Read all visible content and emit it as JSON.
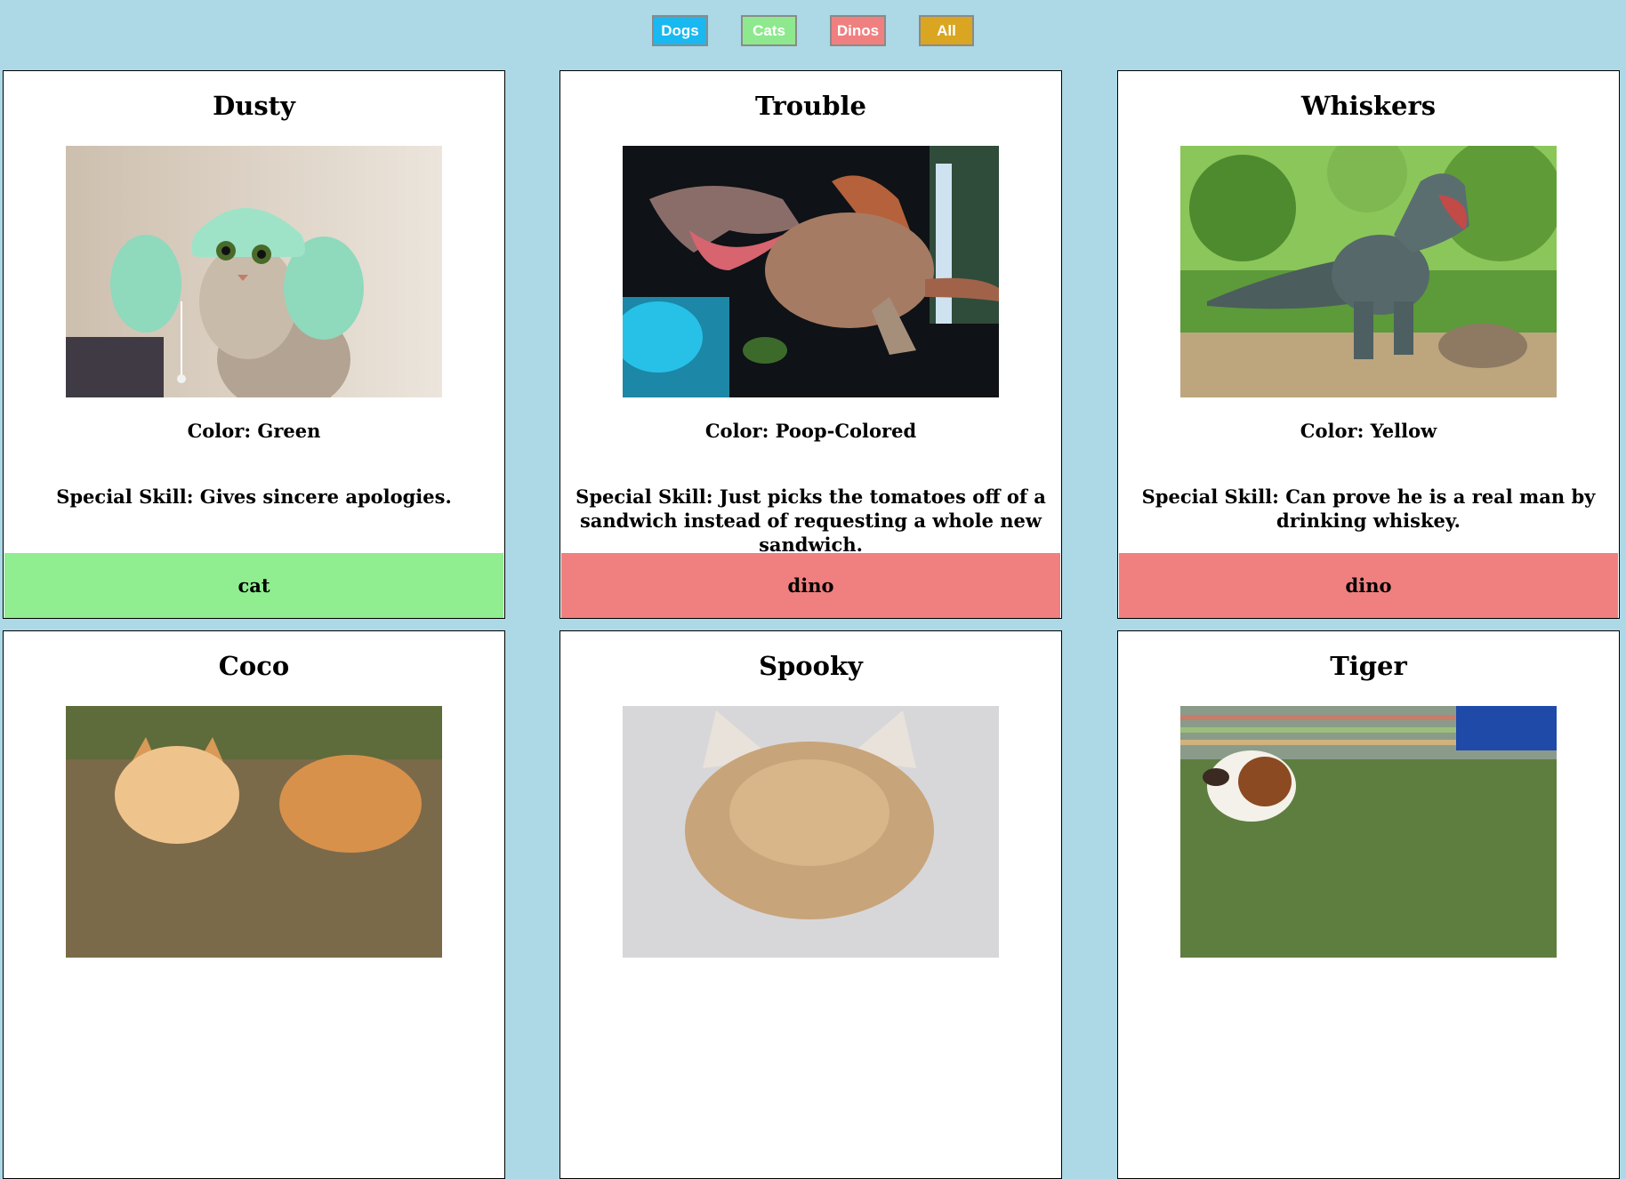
{
  "filters": {
    "dogs": "Dogs",
    "cats": "Cats",
    "dinos": "Dinos",
    "all": "All"
  },
  "colors": {
    "page_background": "#add8e6",
    "dogs_button": "#1ab8f0",
    "cats_button": "#8ee98e",
    "dinos_button": "#f08080",
    "all_button": "#daa520",
    "cat_type": "#90ee90",
    "dino_type": "#f08080"
  },
  "cards": [
    {
      "name": "Dusty",
      "photo_icon": "cat-wearing-green-hat-photo",
      "color": "Color: Green",
      "skill": "Special Skill: Gives sincere apologies.",
      "type": "cat"
    },
    {
      "name": "Trouble",
      "photo_icon": "spinosaurus-model-photo",
      "color": "Color: Poop-Colored",
      "skill": "Special Skill: Just picks the tomatoes off of a sandwich instead of requesting a whole new sandwich.",
      "type": "dino"
    },
    {
      "name": "Whiskers",
      "photo_icon": "trex-statue-in-forest-photo",
      "color": "Color: Yellow",
      "skill": "Special Skill: Can prove he is a real man by drinking whiskey.",
      "type": "dino"
    },
    {
      "name": "Coco",
      "photo_icon": "corgi-dogs-photo"
    },
    {
      "name": "Spooky",
      "photo_icon": "fluffy-cat-ears-photo"
    },
    {
      "name": "Tiger",
      "photo_icon": "basset-hound-photo"
    }
  ]
}
